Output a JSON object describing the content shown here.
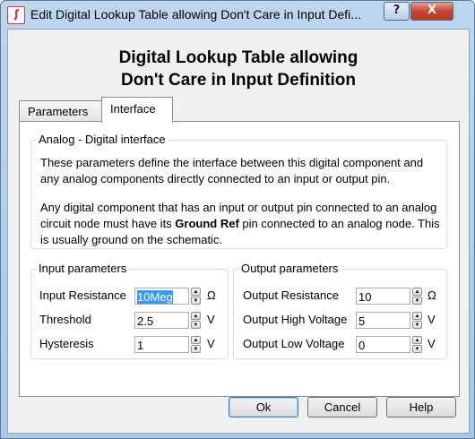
{
  "window": {
    "title": "Edit Digital Lookup Table allowing Don't Care in Input Defi...",
    "help_glyph": "?",
    "close_glyph": "X"
  },
  "heading": {
    "line1": "Digital Lookup Table allowing",
    "line2": "Don't Care in Input Definition"
  },
  "tabs": [
    {
      "label": "Parameters",
      "selected": false
    },
    {
      "label": "Interface",
      "selected": true
    }
  ],
  "analog_group": {
    "legend": "Analog - Digital interface",
    "para1": "These parameters define the interface between this digital component and any analog components directly connected to an input or output pin.",
    "para2_before": "Any digital component that has an input or output pin connected to an analog circuit node must have its ",
    "para2_bold": "Ground Ref",
    "para2_after": " pin connected to an analog node. This is usually ground on the schematic."
  },
  "input_group": {
    "legend": "Input parameters",
    "rows": [
      {
        "label": "Input Resistance",
        "value": "10Meg",
        "unit": "Ω",
        "selected": true
      },
      {
        "label": "Threshold",
        "value": "2.5",
        "unit": "V"
      },
      {
        "label": "Hysteresis",
        "value": "1",
        "unit": "V"
      }
    ]
  },
  "output_group": {
    "legend": "Output parameters",
    "rows": [
      {
        "label": "Output Resistance",
        "value": "10",
        "unit": "Ω"
      },
      {
        "label": "Output High Voltage",
        "value": "5",
        "unit": "V"
      },
      {
        "label": "Output Low Voltage",
        "value": "0",
        "unit": "V"
      }
    ]
  },
  "buttons": {
    "ok": "Ok",
    "cancel": "Cancel",
    "help": "Help"
  },
  "colors": {
    "selection": "#3399ff",
    "close_button": "#c5452f",
    "title_bar": "#bdd6ee"
  }
}
